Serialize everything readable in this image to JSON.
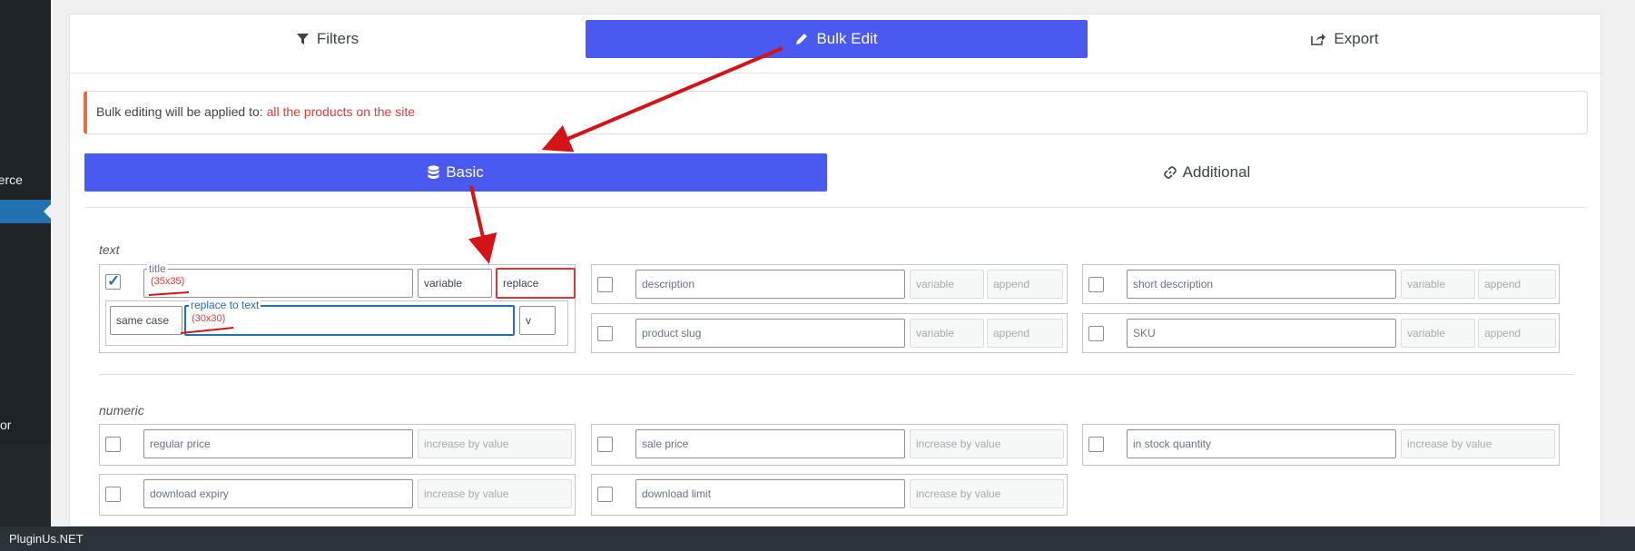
{
  "sidebar": {
    "item_commerce": "merce",
    "item_or": "or"
  },
  "footer": {
    "brand": "PluginUs.NET"
  },
  "top_tabs": [
    {
      "label": "Filters",
      "icon": "filter-icon"
    },
    {
      "label": "Bulk Edit",
      "icon": "pencil-icon"
    },
    {
      "label": "Export",
      "icon": "export-icon"
    }
  ],
  "notice": {
    "prefix": "Bulk editing will be applied to: ",
    "target": "all the products on the site"
  },
  "sub_tabs": [
    {
      "label": "Basic",
      "icon": "database-icon"
    },
    {
      "label": "Additional",
      "icon": "link-icon"
    }
  ],
  "groups": {
    "text": "text",
    "numeric": "numeric"
  },
  "text_fields": {
    "title": {
      "legend": "title",
      "size_note": "(35x35)",
      "variable": "variable",
      "mode": "replace",
      "case": "same case",
      "replace_legend": "replace to text",
      "replace_note": "(30x30)",
      "small": "v"
    },
    "description": {
      "placeholder": "description",
      "variable": "variable",
      "mode": "append"
    },
    "short_description": {
      "placeholder": "short description",
      "variable": "variable",
      "mode": "append"
    },
    "product_slug": {
      "placeholder": "product slug",
      "variable": "variable",
      "mode": "append"
    },
    "sku": {
      "placeholder": "SKU",
      "variable": "variable",
      "mode": "append"
    }
  },
  "numeric_fields": {
    "regular_price": {
      "placeholder": "regular price",
      "mode": "increase by value"
    },
    "sale_price": {
      "placeholder": "sale price",
      "mode": "increase by value"
    },
    "in_stock_quantity": {
      "placeholder": "in stock quantity",
      "mode": "increase by value"
    },
    "download_expiry": {
      "placeholder": "download expiry",
      "mode": "increase by value"
    },
    "download_limit": {
      "placeholder": "download limit",
      "mode": "increase by value"
    }
  },
  "colors": {
    "accent": "#4a5af0",
    "annotation": "#d41414",
    "notice_border": "#e26f3d"
  }
}
